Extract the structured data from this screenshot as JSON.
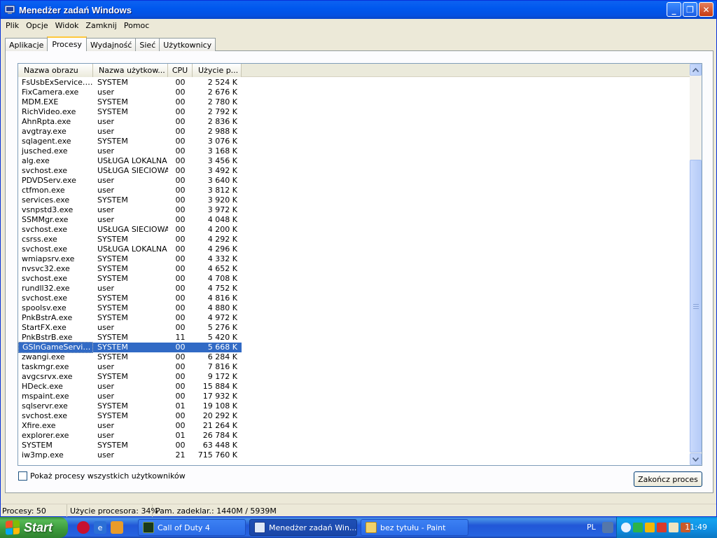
{
  "window": {
    "title": "Menedżer zadań Windows",
    "buttons": {
      "minimize": "_",
      "maximize": "❐",
      "close": "✕"
    }
  },
  "menu": [
    "Plik",
    "Opcje",
    "Widok",
    "Zamknij",
    "Pomoc"
  ],
  "tabs": [
    {
      "label": "Aplikacje",
      "active": false
    },
    {
      "label": "Procesy",
      "active": true
    },
    {
      "label": "Wydajność",
      "active": false
    },
    {
      "label": "Sieć",
      "active": false
    },
    {
      "label": "Użytkownicy",
      "active": false
    }
  ],
  "table": {
    "headers": [
      "Nazwa obrazu",
      "Nazwa użytkow...",
      "CPU",
      "Użycie p..."
    ],
    "selected_index": 27,
    "rows": [
      [
        "FsUsbExService.Exe",
        "SYSTEM",
        "00",
        "2 524 K"
      ],
      [
        "FixCamera.exe",
        "user",
        "00",
        "2 676 K"
      ],
      [
        "MDM.EXE",
        "SYSTEM",
        "00",
        "2 780 K"
      ],
      [
        "RichVideo.exe",
        "SYSTEM",
        "00",
        "2 792 K"
      ],
      [
        "AhnRpta.exe",
        "user",
        "00",
        "2 836 K"
      ],
      [
        "avgtray.exe",
        "user",
        "00",
        "2 988 K"
      ],
      [
        "sqlagent.exe",
        "SYSTEM",
        "00",
        "3 076 K"
      ],
      [
        "jusched.exe",
        "user",
        "00",
        "3 168 K"
      ],
      [
        "alg.exe",
        "USŁUGA LOKALNA",
        "00",
        "3 456 K"
      ],
      [
        "svchost.exe",
        "USŁUGA SIECIOWA",
        "00",
        "3 492 K"
      ],
      [
        "PDVDServ.exe",
        "user",
        "00",
        "3 640 K"
      ],
      [
        "ctfmon.exe",
        "user",
        "00",
        "3 812 K"
      ],
      [
        "services.exe",
        "SYSTEM",
        "00",
        "3 920 K"
      ],
      [
        "vsnpstd3.exe",
        "user",
        "00",
        "3 972 K"
      ],
      [
        "SSMMgr.exe",
        "user",
        "00",
        "4 048 K"
      ],
      [
        "svchost.exe",
        "USŁUGA SIECIOWA",
        "00",
        "4 200 K"
      ],
      [
        "csrss.exe",
        "SYSTEM",
        "00",
        "4 292 K"
      ],
      [
        "svchost.exe",
        "USŁUGA LOKALNA",
        "00",
        "4 296 K"
      ],
      [
        "wmiapsrv.exe",
        "SYSTEM",
        "00",
        "4 332 K"
      ],
      [
        "nvsvc32.exe",
        "SYSTEM",
        "00",
        "4 652 K"
      ],
      [
        "svchost.exe",
        "SYSTEM",
        "00",
        "4 708 K"
      ],
      [
        "rundll32.exe",
        "user",
        "00",
        "4 752 K"
      ],
      [
        "svchost.exe",
        "SYSTEM",
        "00",
        "4 816 K"
      ],
      [
        "spoolsv.exe",
        "SYSTEM",
        "00",
        "4 880 K"
      ],
      [
        "PnkBstrA.exe",
        "SYSTEM",
        "00",
        "4 972 K"
      ],
      [
        "StartFX.exe",
        "user",
        "00",
        "5 276 K"
      ],
      [
        "PnkBstrB.exe",
        "SYSTEM",
        "11",
        "5 420 K"
      ],
      [
        "GSInGameService...",
        "SYSTEM",
        "00",
        "5 668 K"
      ],
      [
        "zwangi.exe",
        "SYSTEM",
        "00",
        "6 284 K"
      ],
      [
        "taskmgr.exe",
        "user",
        "00",
        "7 816 K"
      ],
      [
        "avgcsrvx.exe",
        "SYSTEM",
        "00",
        "9 172 K"
      ],
      [
        "HDeck.exe",
        "user",
        "00",
        "15 884 K"
      ],
      [
        "mspaint.exe",
        "user",
        "00",
        "17 932 K"
      ],
      [
        "sqlservr.exe",
        "SYSTEM",
        "01",
        "19 108 K"
      ],
      [
        "svchost.exe",
        "SYSTEM",
        "00",
        "20 292 K"
      ],
      [
        "Xfire.exe",
        "user",
        "00",
        "21 264 K"
      ],
      [
        "explorer.exe",
        "user",
        "01",
        "26 784 K"
      ],
      [
        "SYSTEM",
        "SYSTEM",
        "00",
        "63 448 K"
      ],
      [
        "iw3mp.exe",
        "user",
        "21",
        "715 760 K"
      ]
    ]
  },
  "checkbox_label": "Pokaż procesy wszystkich użytkowników",
  "end_process_label": "Zakończ proces",
  "status": {
    "processes": "Procesy: 50",
    "cpu": "Użycie procesora: 34%",
    "memory": "Pam. zadeklar.: 1440M / 5939M"
  },
  "taskbar": {
    "start_label": "Start",
    "tasks": [
      {
        "label": "Call of Duty 4",
        "active": false
      },
      {
        "label": "Menedżer zadań Win...",
        "active": true
      },
      {
        "label": "bez tytułu - Paint",
        "active": false
      }
    ],
    "language": "PL",
    "clock": "11:49"
  },
  "colors": {
    "selection": "#316ac5",
    "titlebar": "#0058ee",
    "taskbar": "#2157d7",
    "start": "#3c9a3c",
    "tray": "#0f8de0"
  }
}
